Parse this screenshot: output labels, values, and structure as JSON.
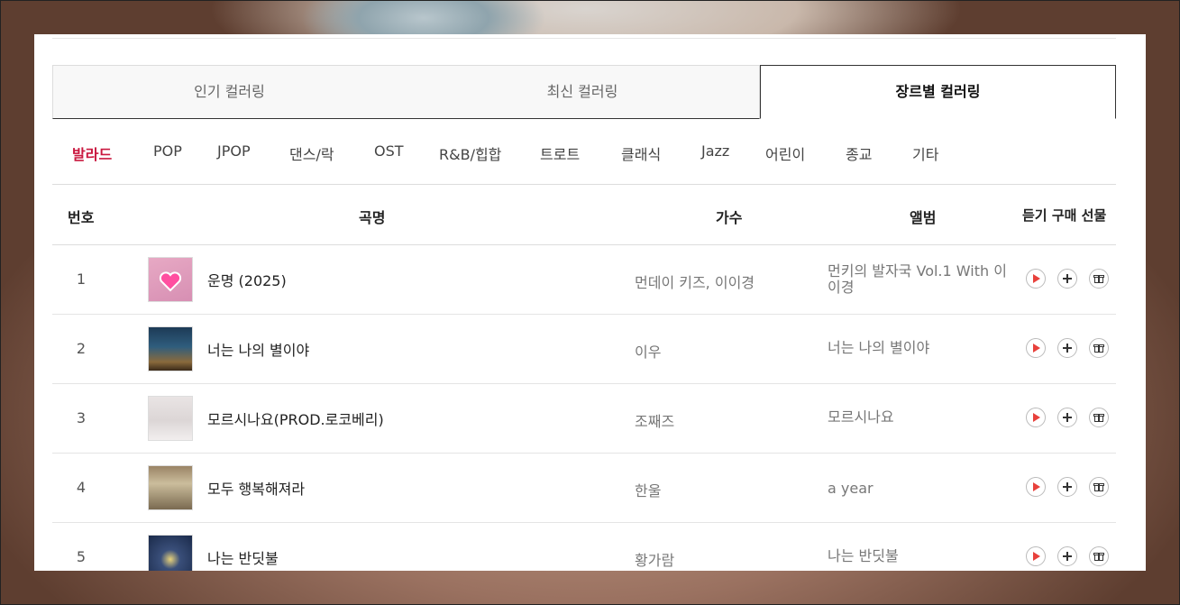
{
  "tabs": [
    "인기 컬러링",
    "최신 컬러링",
    "장르별 컬러링"
  ],
  "active_tab": "장르별 컬러링",
  "genres": [
    "발라드",
    "POP",
    "JPOP",
    "댄스/락",
    "OST",
    "R&B/힙합",
    "트로트",
    "클래식",
    "Jazz",
    "어린이",
    "종교",
    "기타"
  ],
  "active_genre": "발라드",
  "header": {
    "num": "번호",
    "title": "곡명",
    "artist": "가수",
    "album": "앨범",
    "actions": "듣기 구매 선물"
  },
  "rows": [
    {
      "num": "1",
      "title": "운명 (2025)",
      "artist": "먼데이 키즈, 이이경",
      "album": "먼키의 발자국 Vol.1 With 이이경"
    },
    {
      "num": "2",
      "title": "너는 나의 별이야",
      "artist": "이우",
      "album": "너는 나의 별이야"
    },
    {
      "num": "3",
      "title": "모르시나요(PROD.로코베리)",
      "artist": "조째즈",
      "album": "모르시나요"
    },
    {
      "num": "4",
      "title": "모두 행복해져라",
      "artist": "한울",
      "album": "a year"
    },
    {
      "num": "5",
      "title": "나는 반딧불",
      "artist": "황가람",
      "album": "나는 반딧불"
    }
  ],
  "colors": {
    "accent": "#c9183f",
    "play": "#e8413c"
  },
  "icons": [
    "play-icon",
    "plus-icon",
    "gift-icon"
  ]
}
